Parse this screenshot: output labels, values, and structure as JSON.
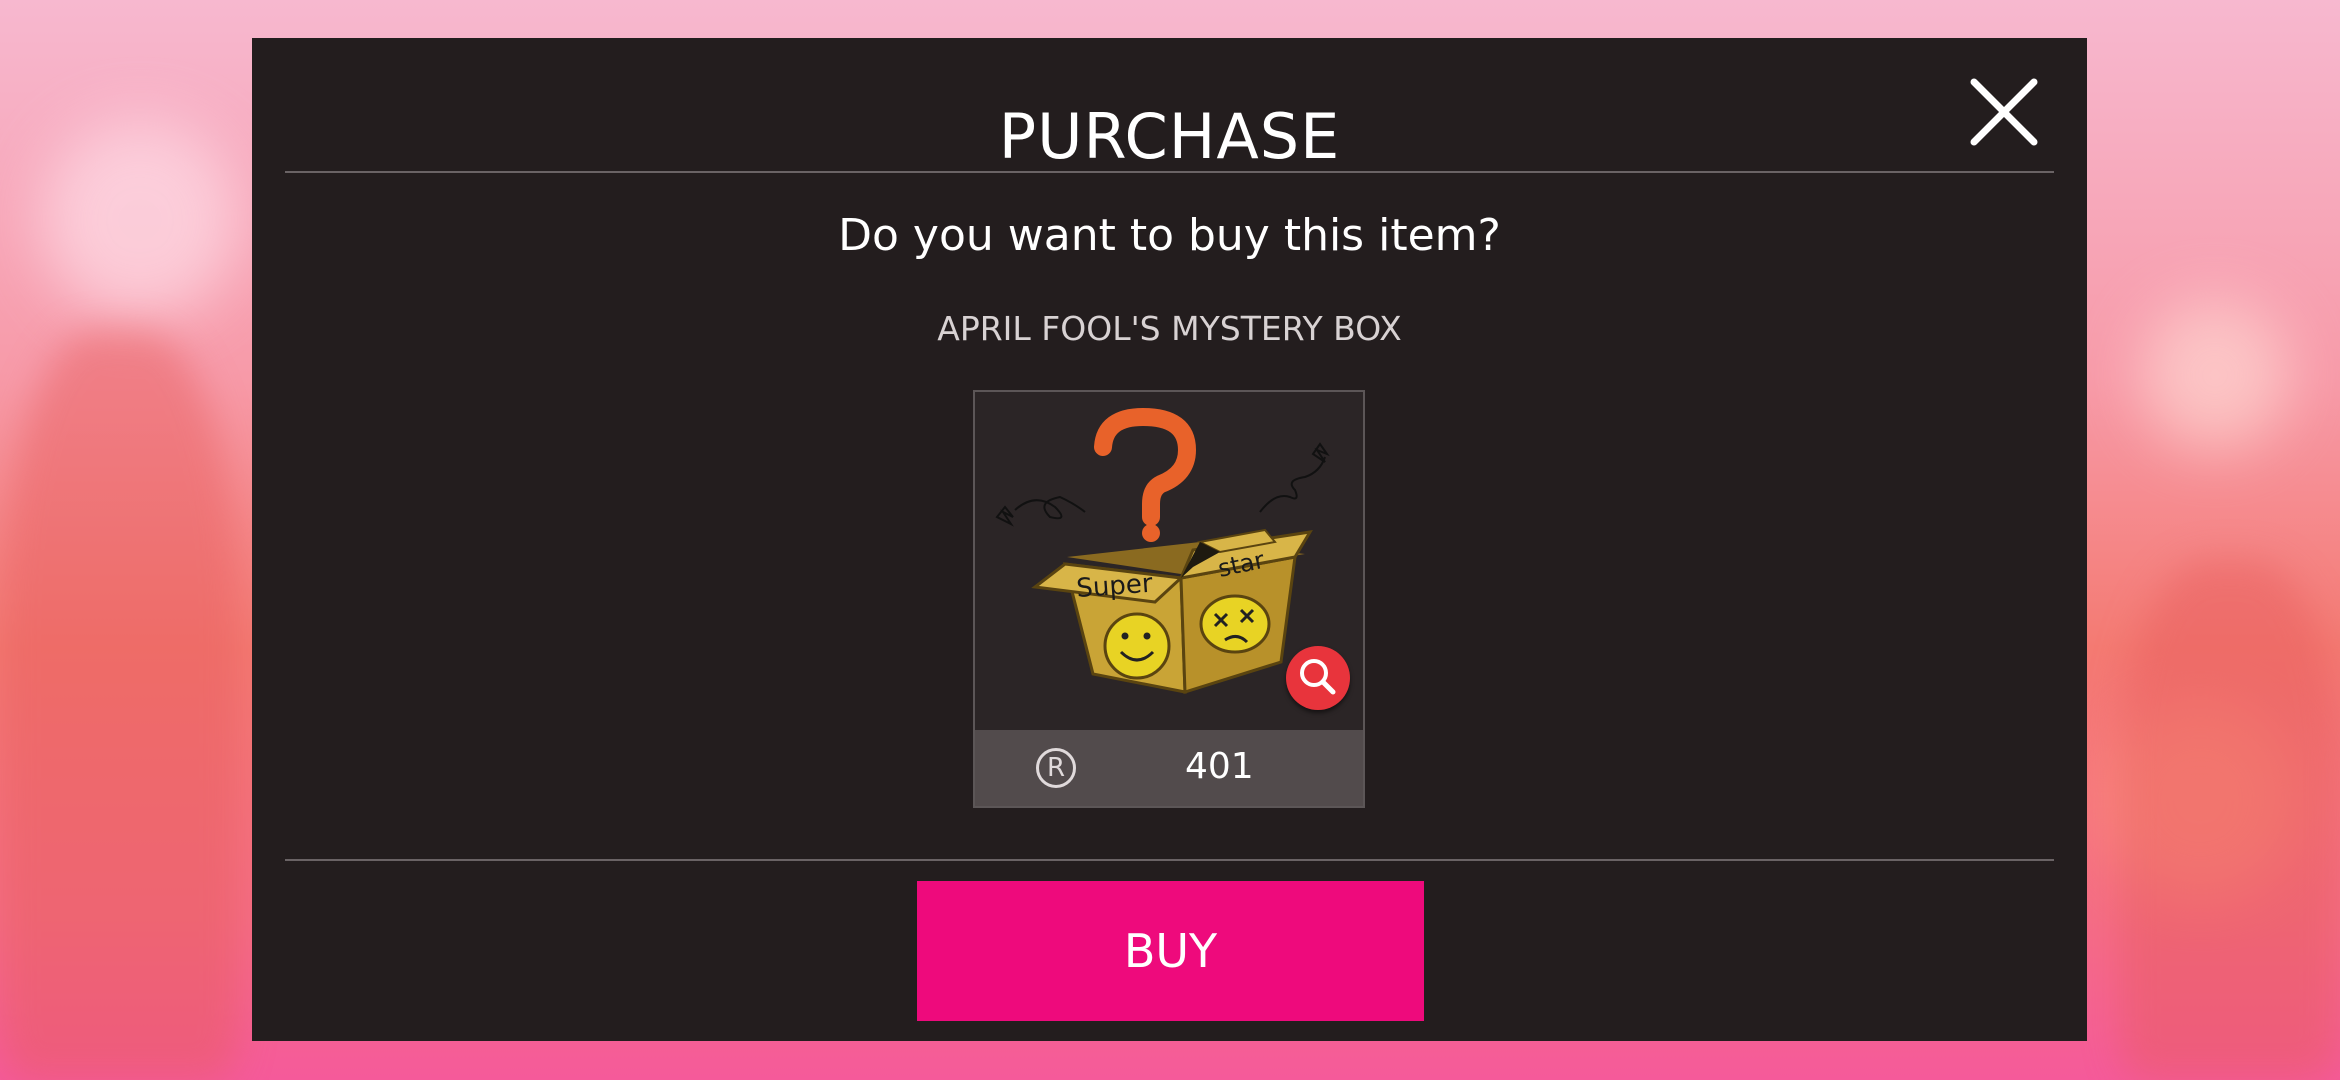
{
  "dialog": {
    "title": "PURCHASE",
    "question": "Do you want to buy this item?",
    "item_name": "APRIL FOOL'S MYSTERY BOX",
    "price": "401",
    "currency_symbol": "R",
    "buy_label": "BUY",
    "box_text_left": "Super",
    "box_text_right": "star"
  },
  "icons": {
    "close": "close-icon",
    "zoom": "magnifier-icon",
    "currency": "currency-r-icon"
  },
  "colors": {
    "dialog_bg": "#231d1e",
    "buy_button": "#ee0a7c",
    "zoom_button": "#e8343c",
    "price_bar": "#524b4c"
  }
}
